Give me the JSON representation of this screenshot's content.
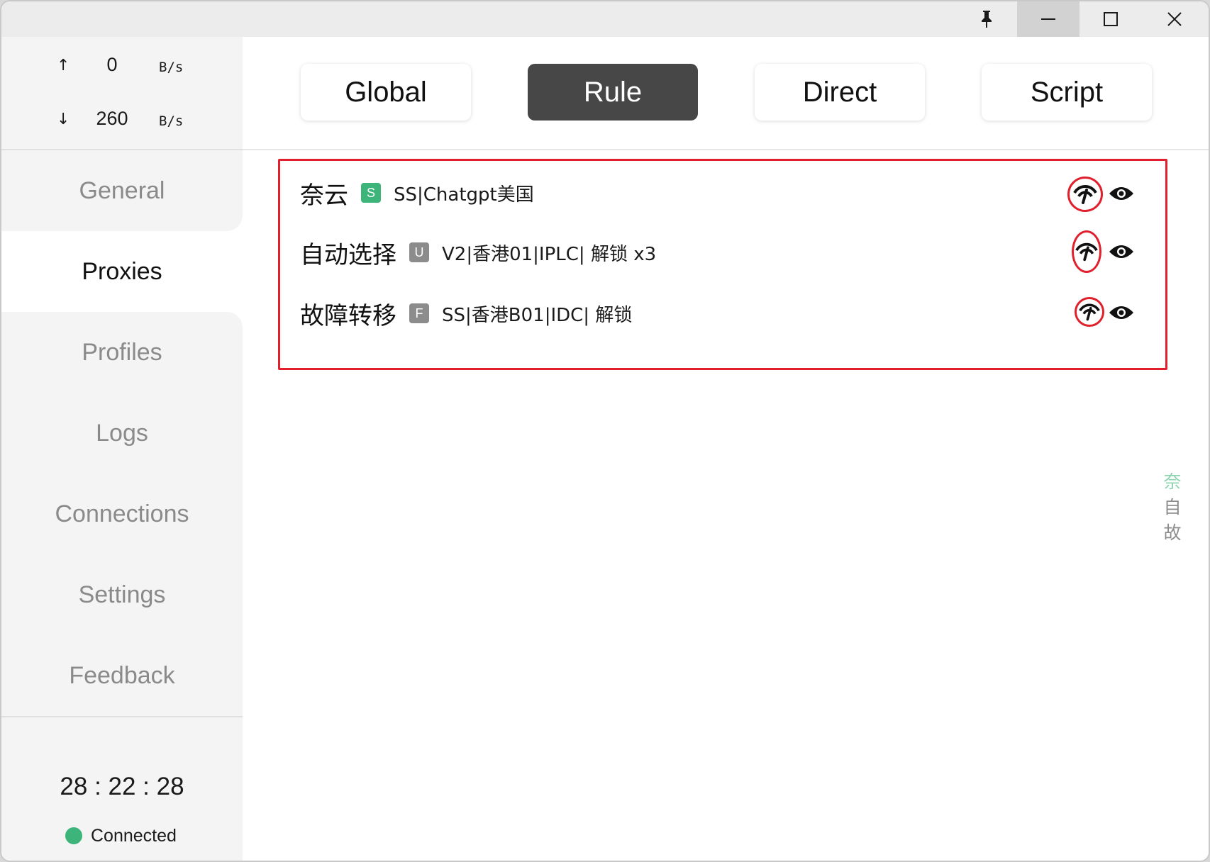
{
  "window": {
    "buttons": [
      "pin-icon",
      "minimize-icon",
      "maximize-icon",
      "close-icon"
    ]
  },
  "traffic": {
    "up": {
      "arrow": "↑",
      "value": "0",
      "unit": "B/s"
    },
    "down": {
      "arrow": "↓",
      "value": "260",
      "unit": "B/s"
    }
  },
  "nav": [
    {
      "label": "General"
    },
    {
      "label": "Proxies"
    },
    {
      "label": "Profiles"
    },
    {
      "label": "Logs"
    },
    {
      "label": "Connections"
    },
    {
      "label": "Settings"
    },
    {
      "label": "Feedback"
    }
  ],
  "active_nav": "Proxies",
  "uptime": "28 : 22 : 28",
  "status": "Connected",
  "modes": [
    {
      "label": "Global"
    },
    {
      "label": "Rule"
    },
    {
      "label": "Direct"
    },
    {
      "label": "Script"
    }
  ],
  "active_mode": "Rule",
  "groups": [
    {
      "name": "奈云",
      "type": "S",
      "now": "SS|Chatgpt美国"
    },
    {
      "name": "自动选择",
      "type": "U",
      "now": "V2|香港01|IPLC| 解锁 x3"
    },
    {
      "name": "故障转移",
      "type": "F",
      "now": "SS|香港B01|IDC| 解锁"
    }
  ],
  "side_index": [
    "奈",
    "自",
    "故"
  ],
  "colors": {
    "accent_green": "#3cb47a",
    "highlight_red": "#e0202c",
    "active_mode_bg": "#474747"
  }
}
